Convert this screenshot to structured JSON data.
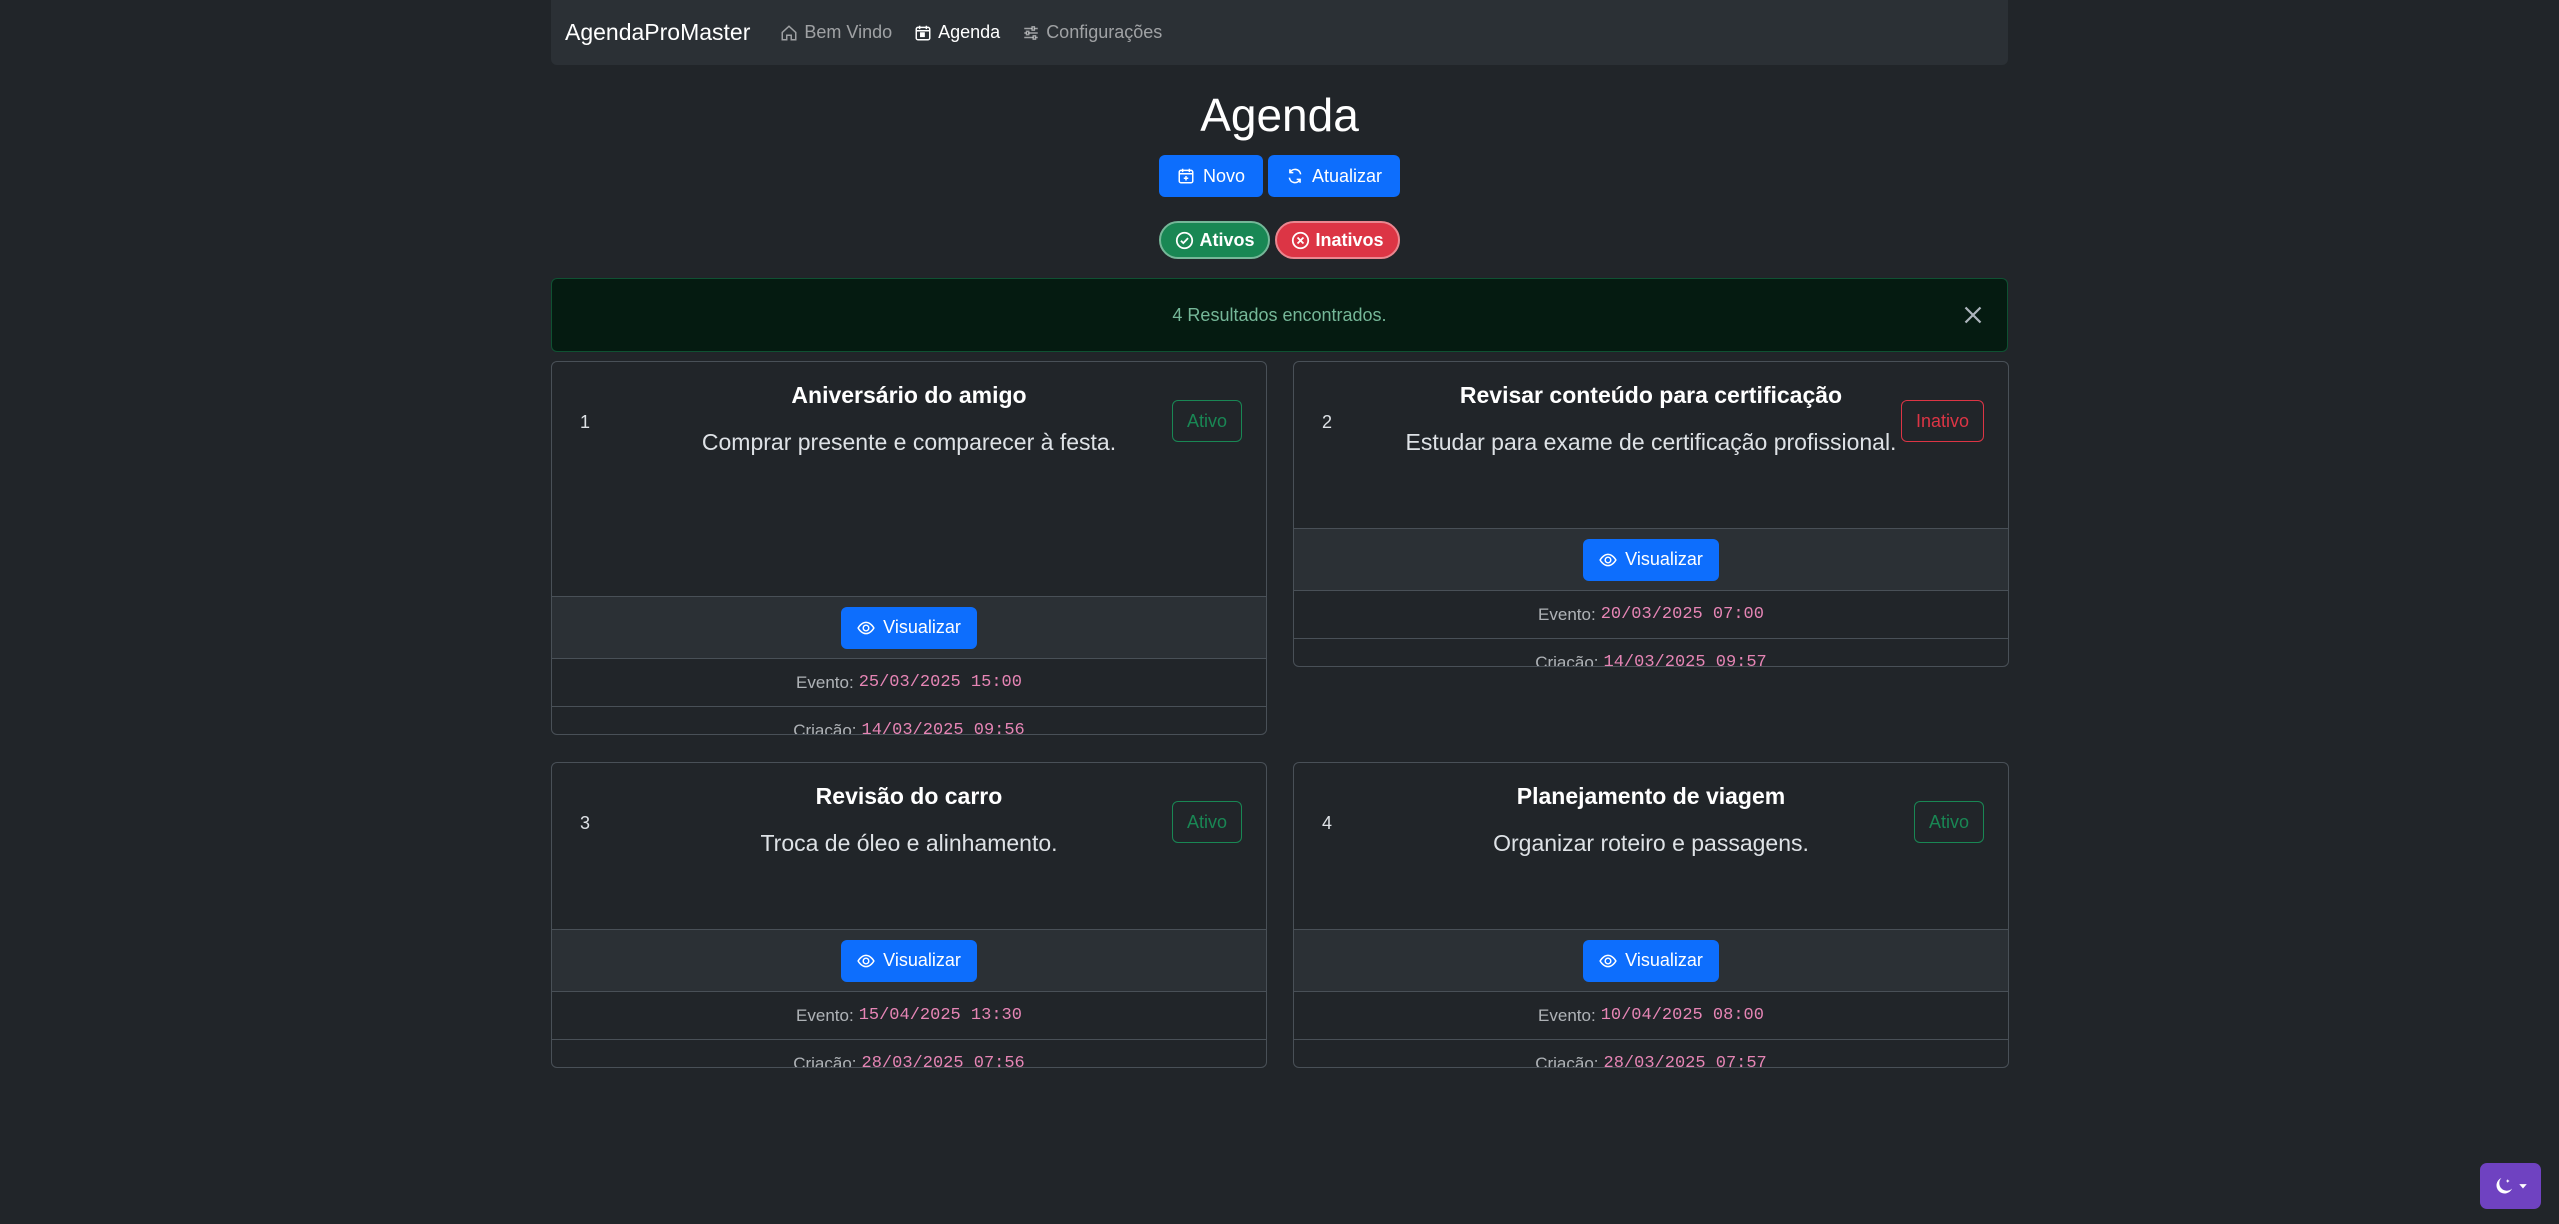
{
  "navbar": {
    "brand": "AgendaProMaster",
    "links": [
      {
        "label": "Bem Vindo",
        "icon": "house-icon"
      },
      {
        "label": "Agenda",
        "icon": "calendar-icon"
      },
      {
        "label": "Configurações",
        "icon": "sliders-icon"
      }
    ]
  },
  "page": {
    "title": "Agenda",
    "new_label": "Novo",
    "refresh_label": "Atualizar",
    "filter_active": "Ativos",
    "filter_inactive": "Inativos",
    "alert_text": "4 Resultados encontrados."
  },
  "labels": {
    "view": "Visualizar",
    "event": "Evento:",
    "created": "Criação:"
  },
  "cards": [
    {
      "num": "1",
      "title": "Aniversário do amigo",
      "text": "Comprar presente e comparecer à festa.",
      "status": "Ativo",
      "event": "25/03/2025 15:00",
      "created": "14/03/2025 09:56"
    },
    {
      "num": "2",
      "title": "Revisar conteúdo para certificação",
      "text": "Estudar para exame de certificação profissional.",
      "status": "Inativo",
      "event": "20/03/2025 07:00",
      "created": "14/03/2025 09:57"
    },
    {
      "num": "3",
      "title": "Revisão do carro",
      "text": "Troca de óleo e alinhamento.",
      "status": "Ativo",
      "event": "15/04/2025 13:30",
      "created": "28/03/2025 07:56"
    },
    {
      "num": "4",
      "title": "Planejamento de viagem",
      "text": "Organizar roteiro e passagens.",
      "status": "Ativo",
      "event": "10/04/2025 08:00",
      "created": "28/03/2025 07:57"
    }
  ],
  "colors": {
    "primary": "#0d6efd",
    "success": "#198754",
    "danger": "#dc3545",
    "background": "#212529",
    "theme_toggle": "#6f42c1"
  }
}
